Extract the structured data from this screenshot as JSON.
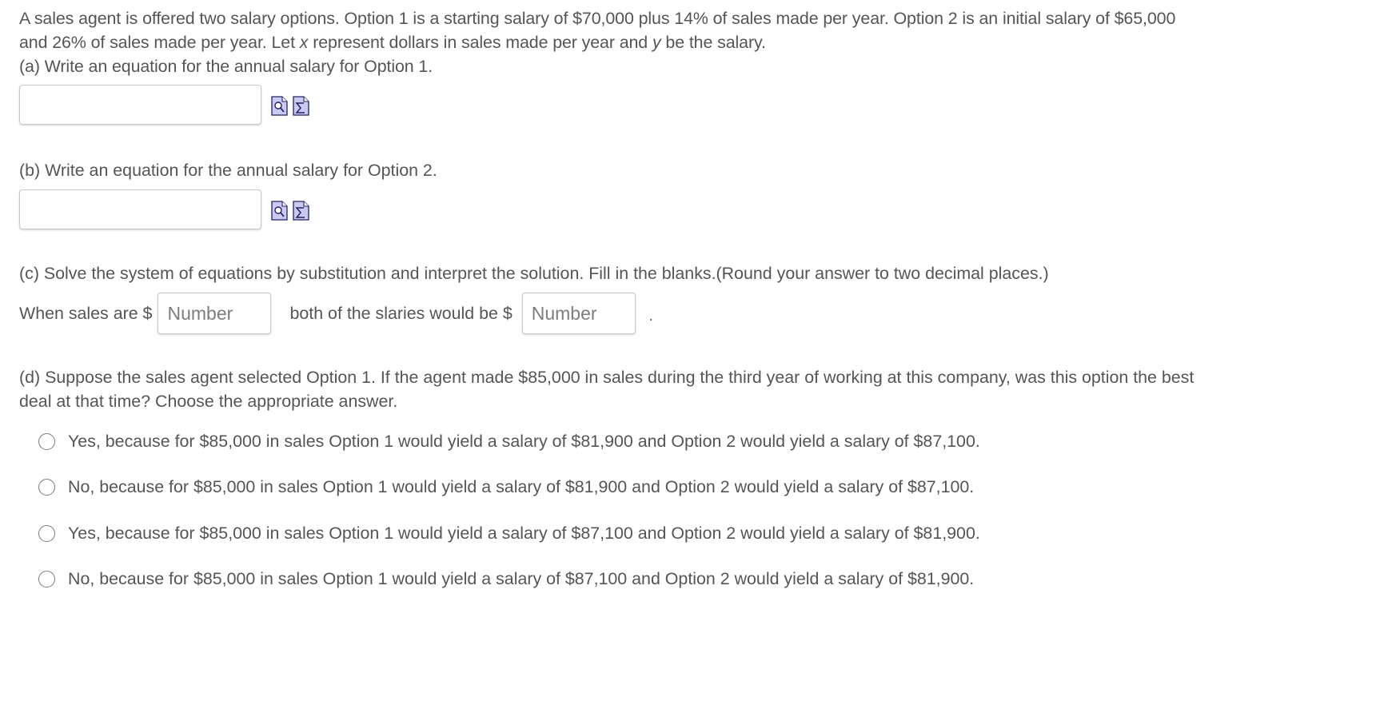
{
  "problem": {
    "line1": "A sales agent is offered two salary options. Option 1 is a starting salary of $70,000 plus 14% of sales made per year. Option 2 is an initial salary of $65,000",
    "line2_pre": "and 26% of sales made per year. Let ",
    "var_x": "x",
    "line2_mid": " represent dollars in sales made per year and ",
    "var_y": "y",
    "line2_post": " be the salary.",
    "part_a": "(a) Write an equation for the annual salary for Option 1."
  },
  "part_b": {
    "label": "(b) Write an equation for the annual salary for Option 2."
  },
  "part_c": {
    "label": "(c) Solve the system of equations by substitution and interpret the solution. Fill in the blanks.(Round your answer to two decimal places.)",
    "prefix": "When sales are $",
    "middle": "both of the slaries would be $",
    "suffix": ".",
    "placeholder1": "Number",
    "placeholder2": "Number"
  },
  "part_d": {
    "line1": "(d) Suppose the sales agent selected Option 1. If the agent made $85,000 in sales during the third year of working at this company, was this option the best",
    "line2": "deal at that time? Choose the appropriate answer.",
    "choices": [
      "Yes, because for $85,000 in sales Option 1 would yield a salary of $81,900 and Option 2 would yield a salary of $87,100.",
      "No, because for $85,000 in sales Option 1 would yield a salary of $81,900 and Option 2 would yield a salary of $87,100.",
      "Yes, because for $85,000 in sales Option 1 would yield a salary of $87,100 and Option 2 would yield a salary of $81,900.",
      "No, because for $85,000 in sales Option 1 would yield a salary of $87,100 and Option 2 would yield a salary of $81,900."
    ]
  },
  "icons": {
    "preview": "preview-icon",
    "equation_editor": "equation-editor-icon"
  },
  "colors": {
    "text": "#555555",
    "icon_fill": "#c9c9f2",
    "icon_border": "#222266"
  }
}
